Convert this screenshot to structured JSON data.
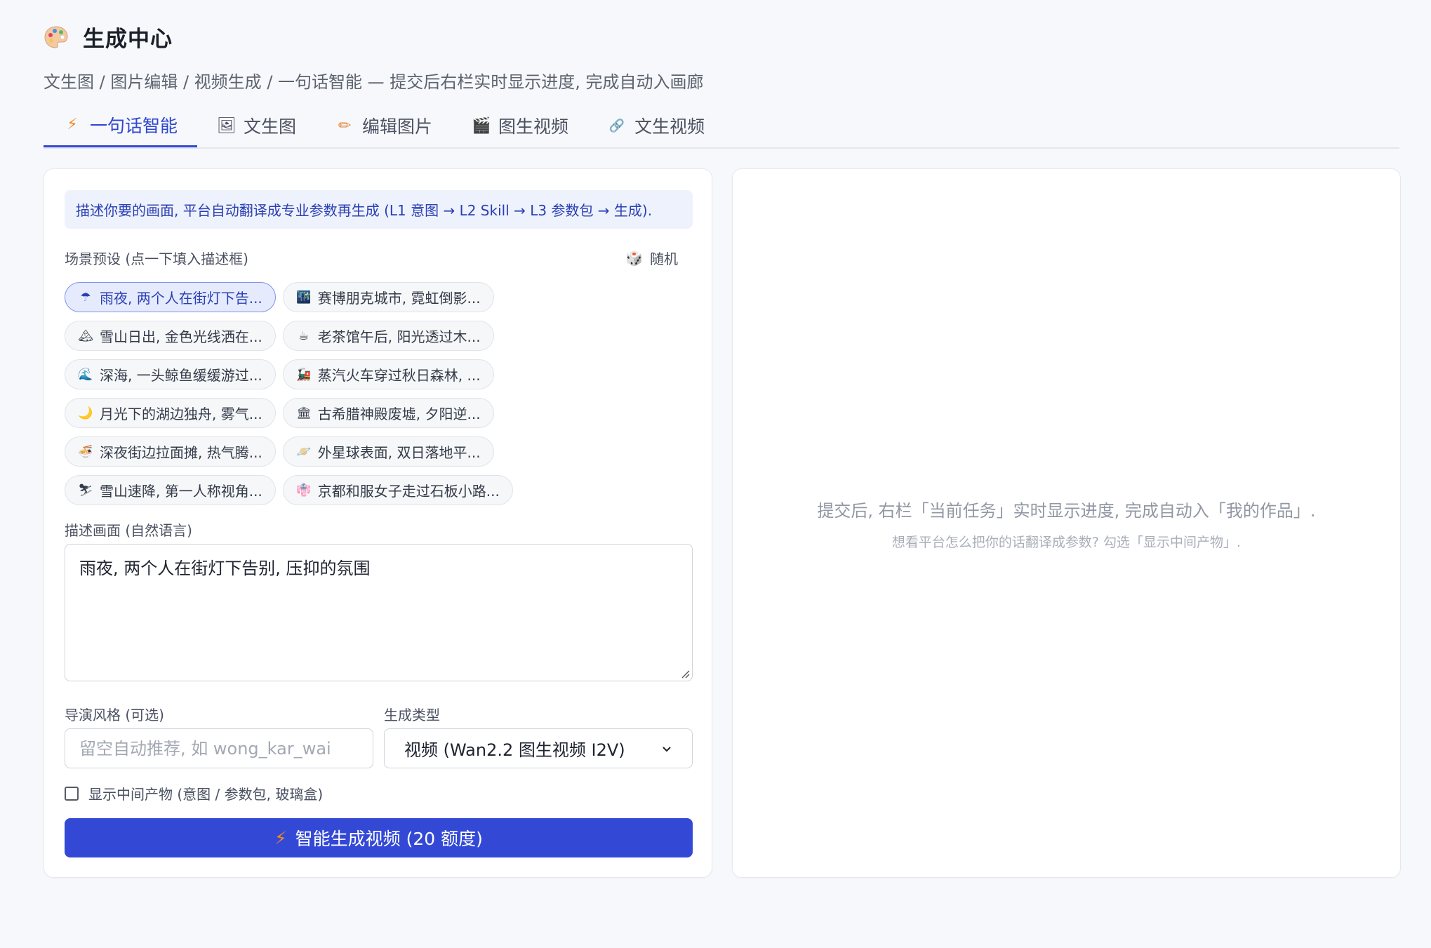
{
  "header": {
    "title": "生成中心",
    "subtitle": "文生图 / 图片编辑 / 视频生成 / 一句话智能 — 提交后右栏实时显示进度, 完成自动入画廊"
  },
  "tabs": [
    {
      "label": "一句话智能",
      "icon": "lightning-icon",
      "glyph": "⚡",
      "active": true
    },
    {
      "label": "文生图",
      "icon": "image-icon",
      "glyph": "🖼",
      "active": false
    },
    {
      "label": "编辑图片",
      "icon": "pencil-icon",
      "glyph": "✏",
      "active": false
    },
    {
      "label": "图生视频",
      "icon": "clapper-icon",
      "glyph": "🎬",
      "active": false
    },
    {
      "label": "文生视频",
      "icon": "link-icon",
      "glyph": "🔗",
      "active": false
    }
  ],
  "form": {
    "info": "描述你要的画面, 平台自动翻译成专业参数再生成 (L1 意图 → L2 Skill → L3 参数包 → 生成).",
    "preset_label": "场景预设 (点一下填入描述框)",
    "random_label": "随机",
    "presets": [
      [
        {
          "text": "雨夜, 两个人在街灯下告...",
          "glyph": "☂",
          "selected": true
        },
        {
          "text": "赛博朋克城市, 霓虹倒影...",
          "glyph": "🌃",
          "selected": false
        }
      ],
      [
        {
          "text": "雪山日出, 金色光线洒在...",
          "glyph": "🏔",
          "selected": false
        },
        {
          "text": "老茶馆午后, 阳光透过木...",
          "glyph": "☕",
          "selected": false
        }
      ],
      [
        {
          "text": "深海, 一头鲸鱼缓缓游过...",
          "glyph": "🌊",
          "selected": false
        },
        {
          "text": "蒸汽火车穿过秋日森林, ...",
          "glyph": "🚂",
          "selected": false
        }
      ],
      [
        {
          "text": "月光下的湖边独舟, 雾气...",
          "glyph": "🌙",
          "selected": false
        },
        {
          "text": "古希腊神殿废墟, 夕阳逆...",
          "glyph": "🏛",
          "selected": false
        }
      ],
      [
        {
          "text": "深夜街边拉面摊, 热气腾...",
          "glyph": "🍜",
          "selected": false
        },
        {
          "text": "外星球表面, 双日落地平...",
          "glyph": "🪐",
          "selected": false
        }
      ],
      [
        {
          "text": "雪山速降, 第一人称视角...",
          "glyph": "⛷",
          "selected": false
        },
        {
          "text": "京都和服女子走过石板小路...",
          "glyph": "👘",
          "selected": false
        }
      ]
    ],
    "desc_label": "描述画面 (自然语言)",
    "desc_value": "雨夜, 两个人在街灯下告别, 压抑的氛围",
    "style_label": "导演风格 (可选)",
    "style_placeholder": "留空自动推荐, 如 wong_kar_wai",
    "type_label": "生成类型",
    "type_value": "视频 (Wan2.2 图生视频 I2V)",
    "show_intermediate": "显示中间产物 (意图 / 参数包, 玻璃盒)",
    "submit_label": "智能生成视频 (20 额度)"
  },
  "result": {
    "empty_main": "提交后, 右栏「当前任务」实时显示进度, 完成自动入「我的作品」.",
    "empty_sub": "想看平台怎么把你的话翻译成参数? 勾选「显示中间产物」."
  },
  "colors": {
    "accent": "#3349d6",
    "page_bg": "#f7f8fb"
  }
}
